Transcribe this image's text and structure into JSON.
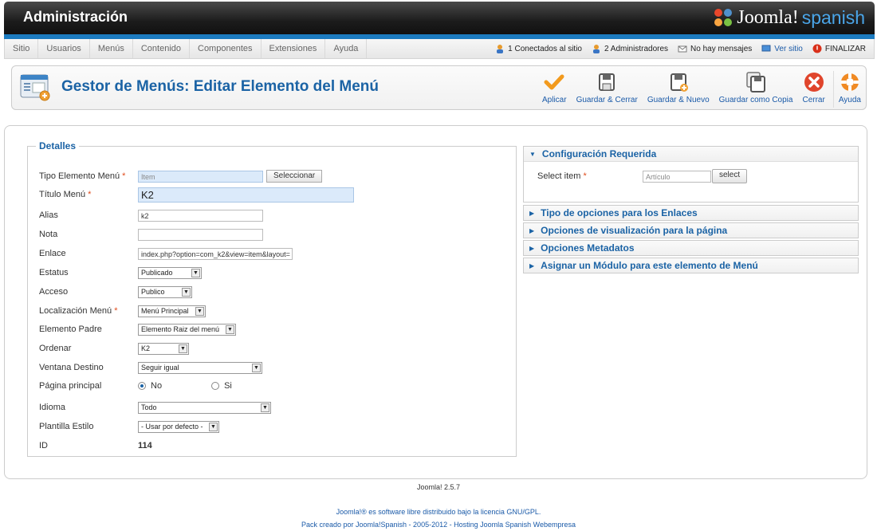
{
  "header": {
    "title": "Administración",
    "logo_joomla": "Joomla!",
    "logo_spanish": "spanish"
  },
  "menu": [
    "Sitio",
    "Usuarios",
    "Menús",
    "Contenido",
    "Componentes",
    "Extensiones",
    "Ayuda"
  ],
  "status": {
    "connected": "1 Conectados al sitio",
    "admins": "2 Administradores",
    "messages": "No hay mensajes",
    "view_site": "Ver sitio",
    "logout": "FINALIZAR"
  },
  "toolbar": {
    "page_title": "Gestor de Menús: Editar Elemento del Menú",
    "buttons": {
      "apply": "Aplicar",
      "save_close": "Guardar & Cerrar",
      "save_new": "Guardar & Nuevo",
      "save_copy": "Guardar como Copia",
      "close": "Cerrar",
      "help": "Ayuda"
    }
  },
  "details": {
    "legend": "Detalles",
    "type_label": "Tipo Elemento Menú",
    "type_value": "Item",
    "select_button": "Seleccionar",
    "title_label": "Título Menú",
    "title_value": "K2",
    "alias_label": "Alias",
    "alias_value": "k2",
    "note_label": "Nota",
    "note_value": "",
    "link_label": "Enlace",
    "link_value": "index.php?option=com_k2&view=item&layout=",
    "status_label": "Estatus",
    "status_value": "Publicado",
    "access_label": "Acceso",
    "access_value": "Publico",
    "location_label": "Localización Menú",
    "location_value": "Menú Principal",
    "parent_label": "Elemento Padre",
    "parent_value": "Elemento Raiz del menú",
    "order_label": "Ordenar",
    "order_value": "K2",
    "target_label": "Ventana Destino",
    "target_value": "Seguir igual",
    "home_label": "Página principal",
    "home_no": "No",
    "home_yes": "Si",
    "language_label": "Idioma",
    "language_value": "Todo",
    "template_label": "Plantilla Estilo",
    "template_value": "- Usar por defecto -",
    "id_label": "ID",
    "id_value": "114",
    "required_mark": "*"
  },
  "panels": {
    "required": {
      "title": "Configuración Requerida",
      "item_label": "Select item",
      "item_placeholder": "Artículo",
      "select_button": "select"
    },
    "link_options": "Tipo de opciones para los Enlaces",
    "display_options": "Opciones de visualización para la página",
    "metadata": "Opciones Metadatos",
    "module_assign": "Asignar un Módulo para este elemento de Menú"
  },
  "footer": {
    "version": "Joomla! 2.5.7",
    "license": "Joomla!® es software libre distribuido bajo la licencia GNU/GPL.",
    "pack": "Pack creado por Joomla!Spanish - 2005-2012 - Hosting Joomla Spanish Webempresa"
  }
}
